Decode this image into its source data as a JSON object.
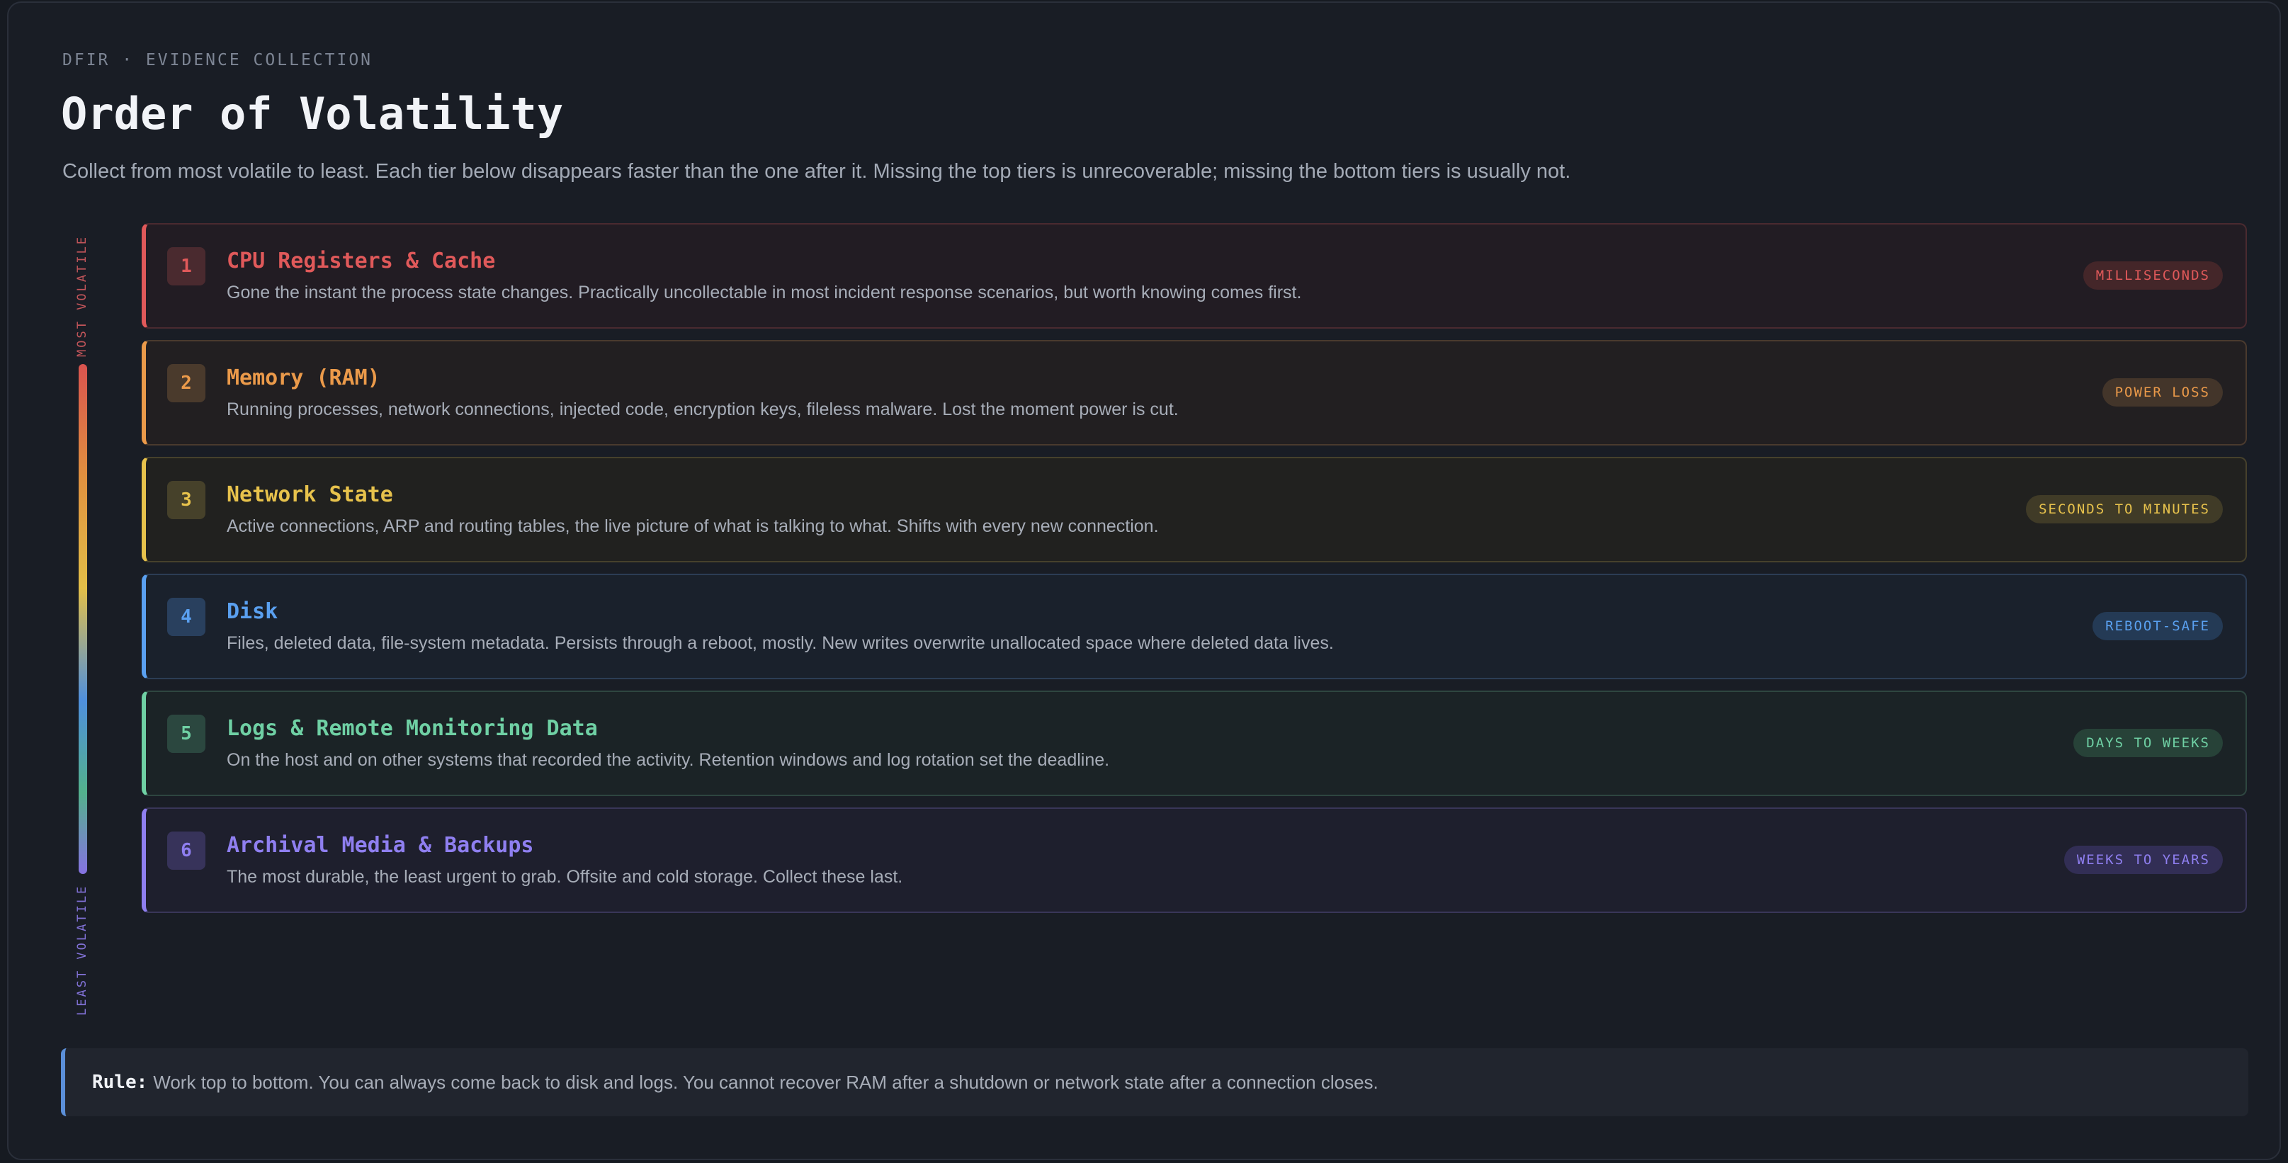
{
  "header": {
    "eyebrow": "DFIR · EVIDENCE COLLECTION",
    "title": "Order of Volatility",
    "subtitle": "Collect from most volatile to least. Each tier below disappears faster than the one after it. Missing the top tiers is unrecoverable; missing the bottom tiers is usually not."
  },
  "axis": {
    "top_label": "MOST VOLATILE",
    "bottom_label": "LEAST VOLATILE"
  },
  "tiers": [
    {
      "number": "1",
      "name": "CPU Registers & Cache",
      "description": "Gone the instant the process state changes. Practically uncollectable in most incident response scenarios, but worth knowing comes first.",
      "badge": "MILLISECONDS",
      "colors": {
        "accent": "#e0595a",
        "bg": "#221c23",
        "border": "#4a2a30",
        "num_bg": "#4a2a2f",
        "badge_bg": "#442629",
        "badge_text": "#e0595a"
      }
    },
    {
      "number": "2",
      "name": "Memory (RAM)",
      "description": "Running processes, network connections, injected code, encryption keys, fileless malware. Lost the moment power is cut.",
      "badge": "POWER LOSS",
      "colors": {
        "accent": "#eb9a4a",
        "bg": "#221f21",
        "border": "#4a3a2e",
        "num_bg": "#4a3a2c",
        "badge_bg": "#43352a",
        "badge_text": "#eb9a4a"
      }
    },
    {
      "number": "3",
      "name": "Network State",
      "description": "Active connections, ARP and routing tables, the live picture of what is talking to what. Shifts with every new connection.",
      "badge": "SECONDS TO MINUTES",
      "colors": {
        "accent": "#e7c24c",
        "bg": "#21211f",
        "border": "#46412c",
        "num_bg": "#46412a",
        "badge_bg": "#403b27",
        "badge_text": "#e7c24c"
      }
    },
    {
      "number": "4",
      "name": "Disk",
      "description": "Files, deleted data, file-system metadata. Persists through a reboot, mostly. New writes overwrite unallocated space where deleted data lives.",
      "badge": "REBOOT-SAFE",
      "colors": {
        "accent": "#5aa0f0",
        "bg": "#1a212c",
        "border": "#2c3d55",
        "num_bg": "#29405e",
        "badge_bg": "#243a55",
        "badge_text": "#5aa0f0"
      }
    },
    {
      "number": "5",
      "name": "Logs & Remote Monitoring Data",
      "description": "On the host and on other systems that recorded the activity. Retention windows and log rotation set the deadline.",
      "badge": "DAYS TO WEEKS",
      "colors": {
        "accent": "#6fd0a4",
        "bg": "#1b2326",
        "border": "#2e4640",
        "num_bg": "#2b473f",
        "badge_bg": "#274238",
        "badge_text": "#6fd0a4"
      }
    },
    {
      "number": "6",
      "name": "Archival Media & Backups",
      "description": "The most durable, the least urgent to grab. Offsite and cold storage. Collect these last.",
      "badge": "WEEKS TO YEARS",
      "colors": {
        "accent": "#8f7ff0",
        "bg": "#1e1f2d",
        "border": "#393658",
        "num_bg": "#37335a",
        "badge_bg": "#322e55",
        "badge_text": "#8f7ff0"
      }
    }
  ],
  "rule": {
    "label": "Rule:",
    "text": "Work top to bottom. You can always come back to disk and logs. You cannot recover RAM after a shutdown or network state after a connection closes.",
    "accent": "#5b8fd8"
  }
}
